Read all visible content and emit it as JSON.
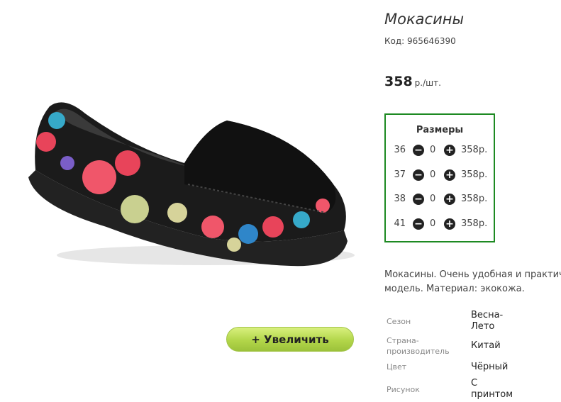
{
  "product": {
    "title": "Мокасины",
    "code": "Код: 965646390",
    "price_value": "358",
    "price_unit": "р./шт.",
    "zoom_label": "+  Увеличить",
    "image_icon": "moccasin-shoe"
  },
  "sizes": {
    "title": "Размеры",
    "rows": [
      {
        "size": "36",
        "qty": "0",
        "price": "358р."
      },
      {
        "size": "37",
        "qty": "0",
        "price": "358р."
      },
      {
        "size": "38",
        "qty": "0",
        "price": "358р."
      },
      {
        "size": "41",
        "qty": "0",
        "price": "358р."
      }
    ]
  },
  "description": {
    "line1": "Мокасины. Очень удобная и практичная",
    "line2": "модель. Материал: экокожа."
  },
  "attributes": [
    {
      "label": [
        "Сезон"
      ],
      "value": [
        "Весна-",
        "Лето"
      ]
    },
    {
      "label": [
        "Страна-",
        "производитель"
      ],
      "value": [
        "Китай"
      ]
    },
    {
      "label": [
        "Цвет"
      ],
      "value": [
        "Чёрный"
      ]
    },
    {
      "label": [
        "Рисунок"
      ],
      "value": [
        "С",
        "принтом"
      ]
    }
  ],
  "colors": {
    "sizes_border": "#1d8a22",
    "zoom_button": "#b3d64a"
  }
}
